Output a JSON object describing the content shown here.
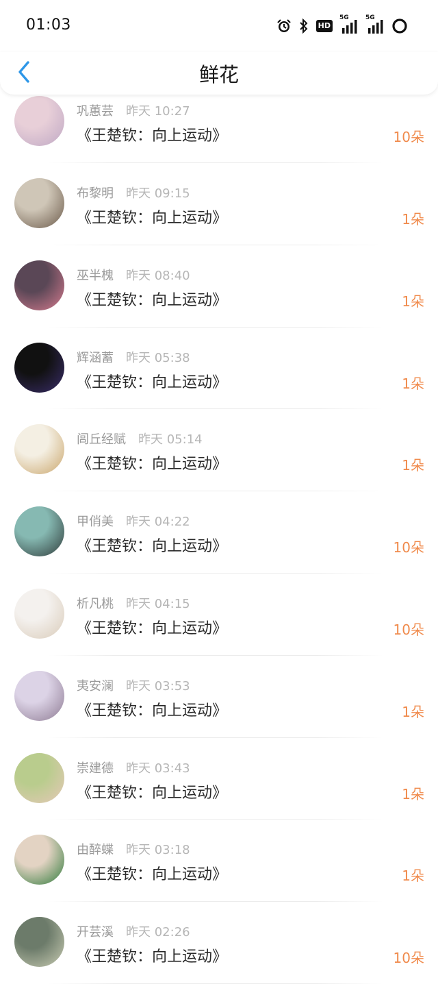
{
  "status_bar": {
    "time": "01:03",
    "hd_badge": "HD",
    "network_label_1": "5G",
    "network_label_2": "5G"
  },
  "header": {
    "title": "鲜花"
  },
  "colors": {
    "accent": "#2e97e8",
    "quantity": "#f08a4b"
  },
  "items": [
    {
      "name": "巩蕙芸",
      "time": "昨天 10:27",
      "book": "《王楚钦：向上运动》",
      "qty": "10朵",
      "avatar_colors": [
        "#e8cfd8",
        "#bfa8c4"
      ]
    },
    {
      "name": "布黎明",
      "time": "昨天 09:15",
      "book": "《王楚钦：向上运动》",
      "qty": "1朵",
      "avatar_colors": [
        "#cfc6b7",
        "#6b5a4a"
      ]
    },
    {
      "name": "巫半槐",
      "time": "昨天 08:40",
      "book": "《王楚钦：向上运动》",
      "qty": "1朵",
      "avatar_colors": [
        "#5a4756",
        "#d77b8f"
      ]
    },
    {
      "name": "辉涵蓄",
      "time": "昨天 05:38",
      "book": "《王楚钦：向上运动》",
      "qty": "1朵",
      "avatar_colors": [
        "#111111",
        "#3a2d6b"
      ]
    },
    {
      "name": "闾丘经赋",
      "time": "昨天 05:14",
      "book": "《王楚钦：向上运动》",
      "qty": "1朵",
      "avatar_colors": [
        "#f4efe3",
        "#caa66c"
      ]
    },
    {
      "name": "甲俏美",
      "time": "昨天 04:22",
      "book": "《王楚钦：向上运动》",
      "qty": "10朵",
      "avatar_colors": [
        "#86b9b2",
        "#2f3b3a"
      ]
    },
    {
      "name": "析凡桃",
      "time": "昨天 04:15",
      "book": "《王楚钦：向上运动》",
      "qty": "10朵",
      "avatar_colors": [
        "#f4f1ee",
        "#d9cbb9"
      ]
    },
    {
      "name": "夷安澜",
      "time": "昨天 03:53",
      "book": "《王楚钦：向上运动》",
      "qty": "1朵",
      "avatar_colors": [
        "#dcd3e6",
        "#8e7b93"
      ]
    },
    {
      "name": "崇建德",
      "time": "昨天 03:43",
      "book": "《王楚钦：向上运动》",
      "qty": "1朵",
      "avatar_colors": [
        "#b9cc8d",
        "#e6c9b8"
      ]
    },
    {
      "name": "由醉蝶",
      "time": "昨天 03:18",
      "book": "《王楚钦：向上运动》",
      "qty": "1朵",
      "avatar_colors": [
        "#e3d3c3",
        "#2f7a3b"
      ]
    },
    {
      "name": "开芸溪",
      "time": "昨天 02:26",
      "book": "《王楚钦：向上运动》",
      "qty": "10朵",
      "avatar_colors": [
        "#6c7b6a",
        "#c9ccb3"
      ]
    }
  ]
}
